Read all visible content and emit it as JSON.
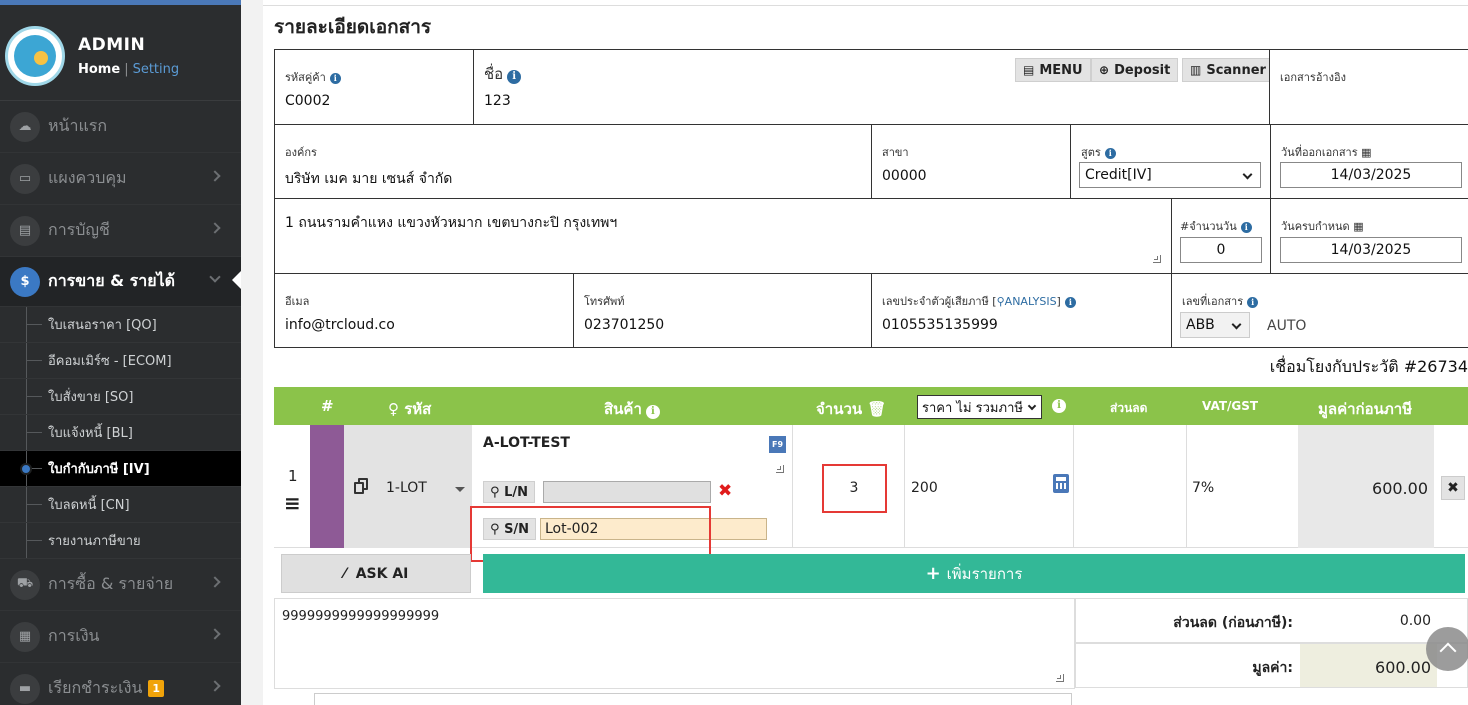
{
  "sidebar": {
    "user_name": "ADMIN",
    "home_link": "Home",
    "separator": "|",
    "setting_link": "Setting",
    "menu": [
      {
        "label": "หน้าแรก",
        "icon": "cloud-icon",
        "glyph": "☁"
      },
      {
        "label": "แผงควบคุม",
        "icon": "monitor-icon",
        "glyph": "▭"
      },
      {
        "label": "การบัญชี",
        "icon": "book-icon",
        "glyph": "▤"
      },
      {
        "label": "การขาย & รายได้",
        "icon": "dollar-icon",
        "glyph": "$"
      },
      {
        "label": "การซื้อ & รายจ่าย",
        "icon": "cart-icon",
        "glyph": "⛟"
      },
      {
        "label": "การเงิน",
        "icon": "calendar-icon",
        "glyph": "▦"
      },
      {
        "label": "เรียกชำระเงิน",
        "icon": "card-icon",
        "glyph": "▬",
        "badge": "1"
      }
    ],
    "submenu": [
      "ใบเสนอราคา [QO]",
      "อีคอมเมิร์ซ - [ECOM]",
      "ใบสั่งขาย [SO]",
      "ใบแจ้งหนี้ [BL]",
      "ใบกำกับภาษี [IV]",
      "ใบลดหนี้ [CN]",
      "รายงานภาษีขาย"
    ]
  },
  "page": {
    "title": "รายละเอียดเอกสาร",
    "history_link": "เชื่อมโยงกับประวัติ #26734"
  },
  "form": {
    "customer_code_label": "รหัสคู่ค้า",
    "customer_code": "C0002",
    "name_label": "ชื่อ",
    "name": "123",
    "menu_button": "MENU",
    "deposit_button": "Deposit",
    "scanner_button": "Scanner",
    "reference_label": "เอกสารอ้างอิง",
    "org_label": "องค์กร",
    "org": "บริษัท เมค มาย เซนส์ จำกัด",
    "branch_label": "สาขา",
    "branch": "00000",
    "formula_label": "สูตร",
    "formula": "Credit[IV]",
    "issue_date_label": "วันที่ออกเอกสาร",
    "issue_date": "14/03/2025",
    "address": "1 ถนนรามคำแหง แขวงหัวหมาก เขตบางกะปิ กรุงเทพฯ",
    "days_label": "#จำนวนวัน",
    "days": "0",
    "due_date_label": "วันครบกำหนด",
    "due_date": "14/03/2025",
    "email_label": "อีเมล",
    "email": "info@trcloud.co",
    "phone_label": "โทรศัพท์",
    "phone": "023701250",
    "tax_id_label": "เลขประจำตัวผู้เสียภาษี",
    "analysis_link": "ANALYSIS",
    "tax_id": "0105535135999",
    "doc_no_label": "เลขที่เอกสาร",
    "doc_prefix": "ABB",
    "doc_auto": "AUTO"
  },
  "items_table": {
    "headers": {
      "no": "#",
      "code": "รหัส",
      "product": "สินค้า",
      "qty": "จำนวน",
      "price_mode": "ราคา ไม่ รวมภาษี",
      "discount": "ส่วนลด",
      "vat": "VAT/GST",
      "net": "มูลค่าก่อนภาษี"
    },
    "row": {
      "no": "1",
      "code": "1-LOT",
      "product": "A-LOT-TEST",
      "f9": "F9",
      "ln_label": "L/N",
      "sn_label": "S/N",
      "sn_value": "Lot-002",
      "qty": "3",
      "price": "200",
      "vat": "7%",
      "net": "600.00"
    },
    "ask_ai": "ASK AI",
    "add_item": "เพิ่มรายการ"
  },
  "summary": {
    "note": "9999999999999999999",
    "discount_label": "ส่วนลด (ก่อนภาษี):",
    "discount_value": "0.00",
    "value_label": "มูลค่า:",
    "value": "600.00"
  },
  "colors": {
    "sidebar_bg": "#2b2d2f",
    "accent_blue": "#3b79c4",
    "table_header_green": "#8bc34a",
    "add_button_teal": "#33b897",
    "row_purple": "#8e5a96",
    "highlight_red": "#e53935"
  }
}
